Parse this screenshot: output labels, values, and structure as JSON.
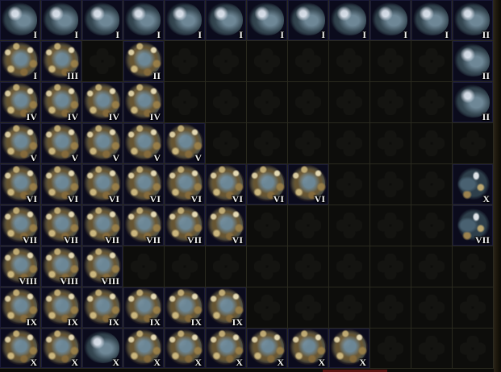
{
  "stash_tab": {
    "rows": [
      [
        {
          "tier": "I",
          "style": "plain"
        },
        {
          "tier": "I",
          "style": "plain"
        },
        {
          "tier": "I",
          "style": "plain"
        },
        {
          "tier": "I",
          "style": "plain"
        },
        {
          "tier": "I",
          "style": "plain"
        },
        {
          "tier": "I",
          "style": "plain"
        },
        {
          "tier": "I",
          "style": "plain"
        },
        {
          "tier": "I",
          "style": "plain"
        },
        {
          "tier": "I",
          "style": "plain"
        },
        {
          "tier": "I",
          "style": "plain"
        },
        {
          "tier": "I",
          "style": "plain"
        },
        {
          "tier": "II",
          "style": "plain"
        }
      ],
      [
        {
          "tier": "I",
          "style": "ore"
        },
        {
          "tier": "III",
          "style": "ore"
        },
        null,
        {
          "tier": "II",
          "style": "ore"
        },
        null,
        null,
        null,
        null,
        null,
        null,
        null,
        {
          "tier": "II",
          "style": "plain"
        }
      ],
      [
        {
          "tier": "IV",
          "style": "ore"
        },
        {
          "tier": "IV",
          "style": "ore"
        },
        {
          "tier": "IV",
          "style": "ore"
        },
        {
          "tier": "IV",
          "style": "ore"
        },
        null,
        null,
        null,
        null,
        null,
        null,
        null,
        {
          "tier": "II",
          "style": "plain"
        }
      ],
      [
        {
          "tier": "V",
          "style": "ore"
        },
        {
          "tier": "V",
          "style": "ore"
        },
        {
          "tier": "V",
          "style": "ore"
        },
        {
          "tier": "V",
          "style": "ore"
        },
        {
          "tier": "V",
          "style": "ore"
        },
        null,
        null,
        null,
        null,
        null,
        null,
        null
      ],
      [
        {
          "tier": "VI",
          "style": "ore"
        },
        {
          "tier": "VI",
          "style": "ore"
        },
        {
          "tier": "VI",
          "style": "ore"
        },
        {
          "tier": "VI",
          "style": "ore"
        },
        {
          "tier": "VI",
          "style": "ore"
        },
        {
          "tier": "VI",
          "style": "ore"
        },
        {
          "tier": "VI",
          "style": "ore"
        },
        {
          "tier": "VI",
          "style": "ore"
        },
        null,
        null,
        null,
        {
          "tier": "X",
          "style": "golem"
        }
      ],
      [
        {
          "tier": "VII",
          "style": "ore"
        },
        {
          "tier": "VII",
          "style": "ore"
        },
        {
          "tier": "VII",
          "style": "ore"
        },
        {
          "tier": "VII",
          "style": "ore"
        },
        {
          "tier": "VII",
          "style": "ore"
        },
        {
          "tier": "VI",
          "style": "ore"
        },
        null,
        null,
        null,
        null,
        null,
        {
          "tier": "VII",
          "style": "golem"
        }
      ],
      [
        {
          "tier": "VIII",
          "style": "ore"
        },
        {
          "tier": "VIII",
          "style": "ore"
        },
        {
          "tier": "VIII",
          "style": "ore"
        },
        null,
        null,
        null,
        null,
        null,
        null,
        null,
        null,
        null
      ],
      [
        {
          "tier": "IX",
          "style": "ore"
        },
        {
          "tier": "IX",
          "style": "ore"
        },
        {
          "tier": "IX",
          "style": "ore"
        },
        {
          "tier": "IX",
          "style": "ore"
        },
        {
          "tier": "IX",
          "style": "ore"
        },
        {
          "tier": "IX",
          "style": "ore"
        },
        null,
        null,
        null,
        null,
        null,
        null
      ],
      [
        {
          "tier": "X",
          "style": "ore"
        },
        {
          "tier": "X",
          "style": "ore"
        },
        {
          "tier": "X",
          "style": "plain"
        },
        {
          "tier": "X",
          "style": "ore"
        },
        {
          "tier": "X",
          "style": "ore"
        },
        {
          "tier": "X",
          "style": "ore"
        },
        {
          "tier": "X",
          "style": "ore"
        },
        {
          "tier": "X",
          "style": "ore"
        },
        {
          "tier": "X",
          "style": "ore"
        },
        null,
        null,
        null
      ]
    ]
  },
  "colors": {
    "empty_cell": "#0d0d0b",
    "filled_cell": "#0b0b1c",
    "grid_line": "#2a2a1f",
    "tier_text": "#f2f2f2",
    "bottom_accent": "#5a1512"
  }
}
